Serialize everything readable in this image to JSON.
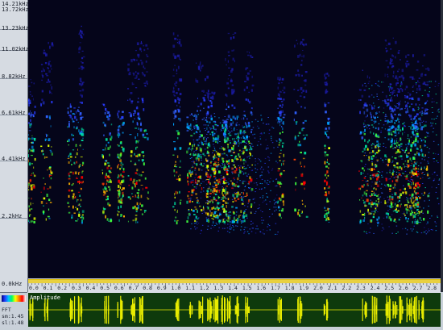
{
  "frequency_axis": {
    "top_labels": [
      "13.72kHz",
      "14.21kHz"
    ],
    "labels": [
      {
        "text": "13.23kHz"
      },
      {
        "text": "11.02kHz"
      },
      {
        "text": "8.82kHz"
      },
      {
        "text": "6.61kHz"
      },
      {
        "text": "4.41kHz"
      },
      {
        "text": "2.2kHz"
      },
      {
        "text": "0.0kHz"
      }
    ]
  },
  "time_axis": {
    "labels": [
      "0.0",
      "0.1",
      "0.2",
      "0.3",
      "0.4",
      "0.5",
      "0.6",
      "0.7",
      "0.8",
      "0.9",
      "1.0",
      "1.1",
      "1.2",
      "1.3",
      "1.4",
      "1.5",
      "1.6",
      "1.7",
      "1.8",
      "1.9",
      "2.0",
      "2.1",
      "2.2",
      "2.3",
      "2.4",
      "2.5",
      "2.6",
      "2.7",
      "2.8"
    ]
  },
  "amplitude_panel": {
    "title": "Amplitude"
  },
  "left_panel": {
    "mode": "FFT",
    "line1": "sm:1.45",
    "line2": "sl:1.48"
  },
  "colors": {
    "spectrogram_bg": "#05051a",
    "amplitude_bg": "#0e3a0c",
    "waveform": "#e8ec00",
    "time_axis_highlight": "#e8d040"
  }
}
